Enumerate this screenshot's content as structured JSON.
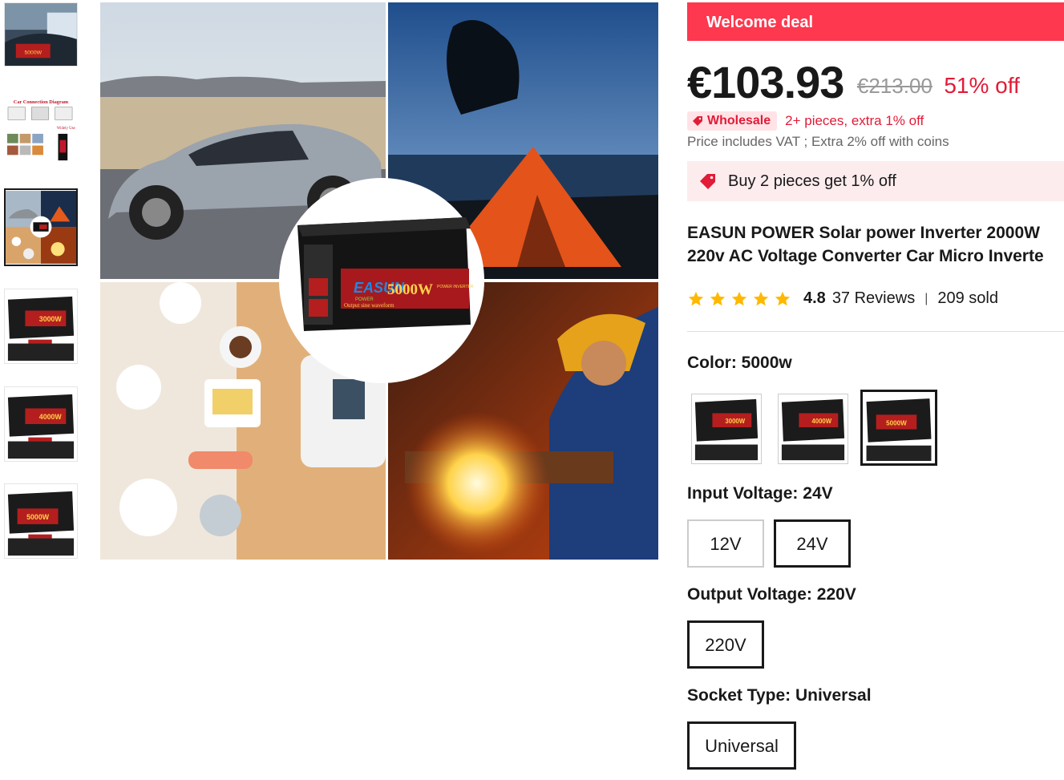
{
  "gallery": {
    "thumbnails": [
      {
        "name": "car-interior-thumbnail",
        "label": "5000W",
        "selected": false
      },
      {
        "name": "car-connection-diagram-thumbnail",
        "label": "Car Connection Diagram",
        "sub": "Widely Use",
        "selected": false
      },
      {
        "name": "usage-collage-thumbnail",
        "label": "",
        "selected": true
      },
      {
        "name": "inverter-3000w-thumbnail",
        "label": "3000W",
        "selected": false
      },
      {
        "name": "inverter-4000w-thumbnail",
        "label": "4000W",
        "selected": false
      },
      {
        "name": "inverter-5000w-thumbnail",
        "label": "5000W",
        "selected": false
      }
    ],
    "main_image": {
      "brand_text": "EASUN",
      "brand_sub": "POWER",
      "power_text": "5000W",
      "model_text": "POWER INVERTER",
      "waveform_text": "Output sine waveform"
    }
  },
  "deal": {
    "banner": "Welcome deal"
  },
  "pricing": {
    "price": "€103.93",
    "original_price": "€213.00",
    "discount": "51% off",
    "wholesale_badge": "Wholesale",
    "wholesale_text": "2+ pieces, extra 1% off",
    "vat_text": "Price includes VAT ; Extra 2% off with coins"
  },
  "promo": {
    "text": "Buy 2 pieces get 1% off"
  },
  "product": {
    "title_line1": "EASUN POWER Solar power Inverter 2000W",
    "title_line2": "220v AC Voltage Converter Car Micro Inverte"
  },
  "rating": {
    "value": "4.8",
    "stars": 5,
    "reviews": "37 Reviews",
    "separator": "|",
    "sold": "209 sold"
  },
  "properties": {
    "color": {
      "label": "Color: ",
      "value": "5000w",
      "options": [
        {
          "name": "color-option-3000w",
          "label": "3000W",
          "selected": false
        },
        {
          "name": "color-option-4000w",
          "label": "4000W",
          "selected": false
        },
        {
          "name": "color-option-5000w",
          "label": "5000W",
          "selected": true
        }
      ]
    },
    "input_voltage": {
      "label": "Input Voltage: ",
      "value": "24V",
      "options": [
        {
          "label": "12V",
          "selected": false
        },
        {
          "label": "24V",
          "selected": true
        }
      ]
    },
    "output_voltage": {
      "label": "Output Voltage: ",
      "value": "220V",
      "options": [
        {
          "label": "220V",
          "selected": true
        }
      ]
    },
    "socket_type": {
      "label": "Socket Type: ",
      "value": "Universal",
      "options": [
        {
          "label": "Universal",
          "selected": true
        }
      ]
    }
  },
  "colors": {
    "accent_red": "#fd384f",
    "price_red": "#e21b37",
    "promo_bg": "#fdecee",
    "star": "#ffb800",
    "text": "#191919"
  }
}
